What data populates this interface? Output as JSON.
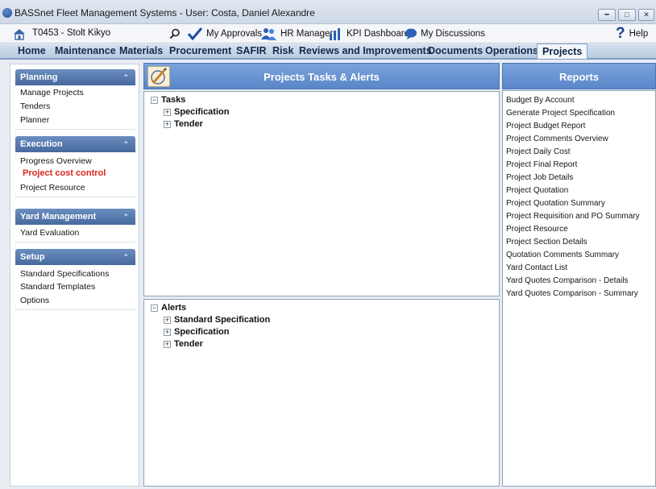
{
  "window": {
    "title": "BASSnet Fleet Management Systems - User: Costa, Daniel Alexandre",
    "controls": [
      "minimize",
      "maximize",
      "close"
    ]
  },
  "toolbar": {
    "vessel": "T0453 - Stolt Kikyo",
    "approvals_label": "My Approvals",
    "hr_label": "HR Manager",
    "kpi_label": "KPI Dashboard",
    "discussions_label": "My Discussions",
    "help_label": "Help"
  },
  "menu": {
    "items": [
      "Home",
      "Maintenance",
      "Materials",
      "Procurement",
      "SAFIR",
      "Risk",
      "Reviews and Improvements",
      "Documents",
      "Operations",
      "Projects"
    ],
    "active": "Projects"
  },
  "sidebar": {
    "planning": {
      "title": "Planning",
      "items": [
        "Manage Projects",
        "Tenders",
        "Planner"
      ]
    },
    "execution": {
      "title": "Execution",
      "items": [
        "Progress Overview",
        "Project cost control",
        "Project Resource"
      ]
    },
    "yard": {
      "title": "Yard Management",
      "items": [
        "Yard Evaluation"
      ]
    },
    "setup": {
      "title": "Setup",
      "items": [
        "Standard Specifications",
        "Standard Templates",
        "Options"
      ]
    }
  },
  "center": {
    "title": "Projects Tasks & Alerts",
    "tasks": {
      "label": "Tasks",
      "children": [
        "Specification",
        "Tender"
      ]
    },
    "alerts": {
      "label": "Alerts",
      "children": [
        "Standard Specification",
        "Specification",
        "Tender"
      ]
    }
  },
  "reports": {
    "title": "Reports",
    "items": [
      "Budget By Account",
      "Generate Project Specification",
      "Project Budget Report",
      "Project Comments Overview",
      "Project Daily Cost",
      "Project Final Report",
      "Project Job Details",
      "Project Quotation",
      "Project Quotation Summary",
      "Project Requisition and PO Summary",
      "Project Resource",
      "Project Section Details",
      "Quotation Comments Summary",
      "Yard Contact List",
      "Yard Quotes Comparison - Details",
      "Yard Quotes Comparison - Summary"
    ]
  },
  "colors": {
    "header_blue": "#5a86c8",
    "section_blue": "#47699e",
    "highlight_red": "#d9261c"
  }
}
